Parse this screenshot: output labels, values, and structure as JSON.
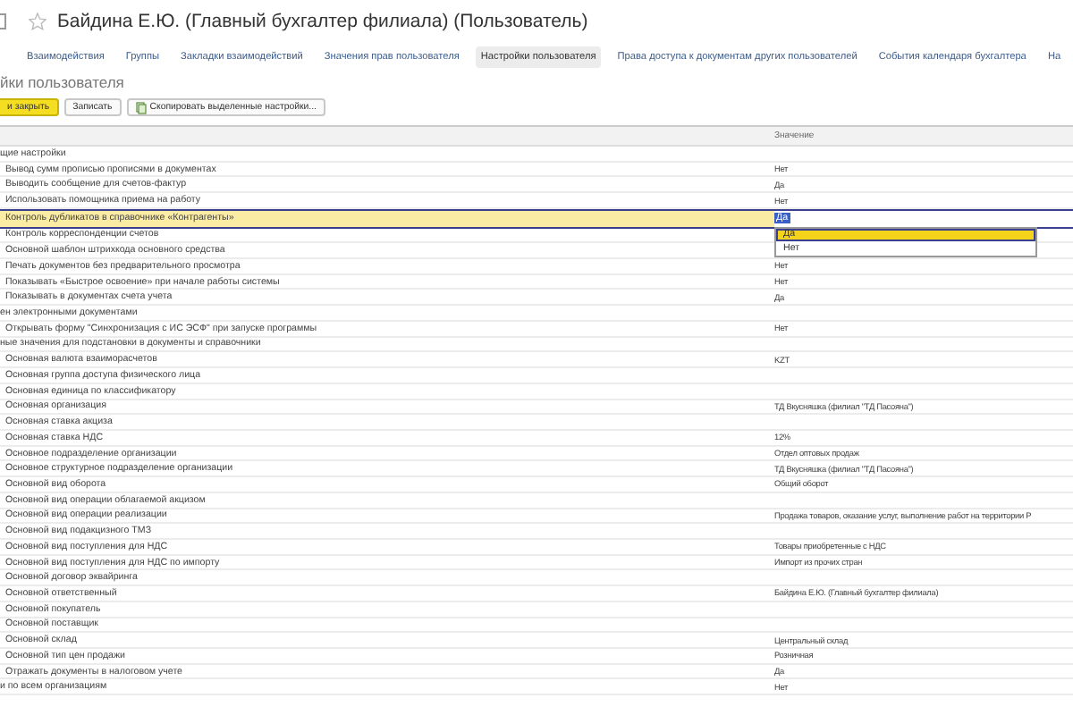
{
  "window": {
    "title": "Байдина Е.Ю. (Главный бухгалтер филиала) (Пользователь)"
  },
  "tabs": [
    {
      "label": "Взаимодействия",
      "selected": false
    },
    {
      "label": "Группы",
      "selected": false
    },
    {
      "label": "Закладки взаимодействий",
      "selected": false
    },
    {
      "label": "Значения прав пользователя",
      "selected": false
    },
    {
      "label": "Настройки пользователя",
      "selected": true
    },
    {
      "label": "Права доступа к документам других пользователей",
      "selected": false
    },
    {
      "label": "События календаря бухгалтера",
      "selected": false
    },
    {
      "label": "На",
      "selected": false
    }
  ],
  "section_title": "йки пользователя",
  "toolbar": {
    "buttons": [
      {
        "label": "и закрыть",
        "kind": "primary"
      },
      {
        "label": "Записать",
        "kind": "plain"
      },
      {
        "label": "Скопировать выделенные настройки...",
        "kind": "icon"
      }
    ]
  },
  "table": {
    "value_header": "Значение",
    "rows": [
      {
        "kind": "group",
        "name": "щие настройки",
        "selected": false
      },
      {
        "kind": "setting",
        "name": "Вывод сумм прописью прописями в документах",
        "value": "Нет",
        "selected": false
      },
      {
        "kind": "setting",
        "name": "Выводить сообщение для счетов-фактур",
        "value": "Да",
        "selected": false
      },
      {
        "kind": "setting",
        "name": "Использовать помощника приема на работу",
        "value": "Нет",
        "selected": false
      },
      {
        "kind": "setting",
        "name": "Контроль дубликатов в справочнике «Контрагенты»",
        "value": "Да",
        "selected": true,
        "dropdown": [
          {
            "label": "Да",
            "selected": true
          },
          {
            "label": "Нет",
            "selected": false
          }
        ]
      },
      {
        "kind": "setting",
        "name": "Контроль корреспонденции счетов",
        "selected": false
      },
      {
        "kind": "setting",
        "name": "Основной шаблон штрихкода основного средства",
        "selected": false
      },
      {
        "kind": "setting",
        "name": "Печать документов без предварительного просмотра",
        "value": "Нет",
        "selected": false
      },
      {
        "kind": "setting",
        "name": "Показывать «Быстрое освоение» при начале работы системы",
        "value": "Нет",
        "selected": false
      },
      {
        "kind": "setting",
        "name": "Показывать в документах счета учета",
        "value": "Да",
        "selected": false
      },
      {
        "kind": "group",
        "name": "ен электронными документами",
        "selected": false
      },
      {
        "kind": "setting",
        "name": "Открывать форму \"Синхронизация с ИС ЭСФ\" при запуске программы",
        "value": "Нет",
        "selected": false
      },
      {
        "kind": "group",
        "name": "ные значения для подстановки в документы и справочники",
        "selected": false
      },
      {
        "kind": "setting",
        "name": "Основная валюта взаиморасчетов",
        "value": "KZT",
        "selected": false
      },
      {
        "kind": "setting",
        "name": "Основная группа доступа физического лица",
        "selected": false
      },
      {
        "kind": "setting",
        "name": "Основная единица по классификатору",
        "selected": false
      },
      {
        "kind": "setting",
        "name": "Основная организация",
        "value": "ТД Вкусняшка (филиал \"ТД Пасояна\")",
        "selected": false
      },
      {
        "kind": "setting",
        "name": "Основная ставка акциза",
        "selected": false
      },
      {
        "kind": "setting",
        "name": "Основная ставка НДС",
        "value": "12%",
        "selected": false
      },
      {
        "kind": "setting",
        "name": "Основное подразделение организации",
        "value": "Отдел оптовых продаж",
        "selected": false
      },
      {
        "kind": "setting",
        "name": "Основное структурное подразделение организации",
        "value": "ТД Вкусняшка (филиал \"ТД Пасояна\")",
        "selected": false
      },
      {
        "kind": "setting",
        "name": "Основной вид оборота",
        "value": "Общий оборот",
        "selected": false
      },
      {
        "kind": "setting",
        "name": "Основной вид операции облагаемой акцизом",
        "selected": false
      },
      {
        "kind": "setting",
        "name": "Основной вид операции реализации",
        "value": "Продажа товаров, оказание услуг, выполнение работ на территории Р",
        "selected": false
      },
      {
        "kind": "setting",
        "name": "Основной вид подакцизного ТМЗ",
        "selected": false
      },
      {
        "kind": "setting",
        "name": "Основной вид поступления для НДС",
        "value": "Товары приобретенные с НДС",
        "selected": false
      },
      {
        "kind": "setting",
        "name": "Основной вид поступления для НДС по импорту",
        "value": "Импорт из прочих стран",
        "selected": false
      },
      {
        "kind": "setting",
        "name": "Основной договор эквайринга",
        "selected": false
      },
      {
        "kind": "setting",
        "name": "Основной ответственный",
        "value": "Байдина Е.Ю. (Главный бухгалтер филиала)",
        "selected": false
      },
      {
        "kind": "setting",
        "name": "Основной покупатель",
        "selected": false
      },
      {
        "kind": "setting",
        "name": "Основной поставщик",
        "selected": false
      },
      {
        "kind": "setting",
        "name": "Основной склад",
        "value": "Центральный склад",
        "selected": false
      },
      {
        "kind": "setting",
        "name": "Основной тип цен продажи",
        "value": "Розничная",
        "selected": false
      },
      {
        "kind": "setting",
        "name": "Отражать документы в налоговом учете",
        "value": "Да",
        "selected": false
      },
      {
        "kind": "group",
        "name": "и по всем организациям",
        "value": "Нет",
        "selected": false
      }
    ]
  }
}
